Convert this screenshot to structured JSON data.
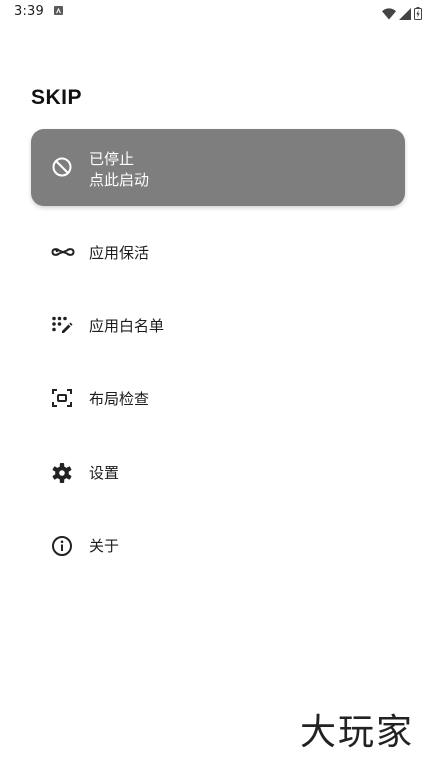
{
  "status_bar": {
    "time": "3:39"
  },
  "app": {
    "title": "SKIP"
  },
  "status_card": {
    "line1": "已停止",
    "line2": "点此启动",
    "icon": "block-icon"
  },
  "menu": {
    "items": [
      {
        "label": "应用保活",
        "icon": "infinity-icon"
      },
      {
        "label": "应用白名单",
        "icon": "dots-edit-icon"
      },
      {
        "label": "布局检查",
        "icon": "center-focus-icon"
      },
      {
        "label": "设置",
        "icon": "gear-icon"
      },
      {
        "label": "关于",
        "icon": "info-icon"
      }
    ]
  },
  "watermark": {
    "text": "大玩家"
  }
}
